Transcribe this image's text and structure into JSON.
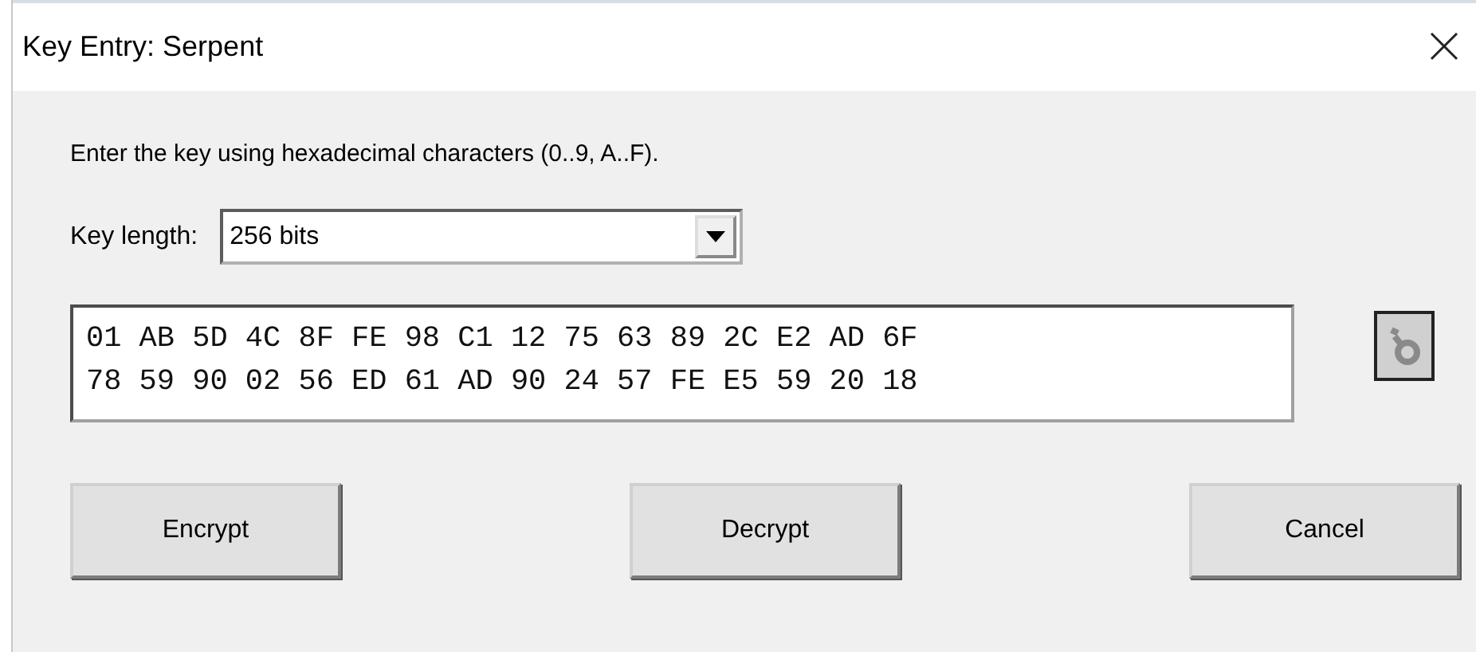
{
  "window": {
    "title": "Key Entry: Serpent"
  },
  "instruction": "Enter the key using hexadecimal characters (0..9, A..F).",
  "key_length": {
    "label": "Key length:",
    "value": "256 bits"
  },
  "key_field": {
    "lines": [
      "01 AB 5D 4C 8F FE 98 C1 12 75 63 89 2C E2 AD 6F",
      "78 59 90 02 56 ED 61 AD 90 24 57 FE E5 59 20 18"
    ]
  },
  "key_tool_button": {
    "disabled": true
  },
  "buttons": [
    {
      "label": "Encrypt"
    },
    {
      "label": "Decrypt"
    },
    {
      "label": "Cancel"
    }
  ]
}
